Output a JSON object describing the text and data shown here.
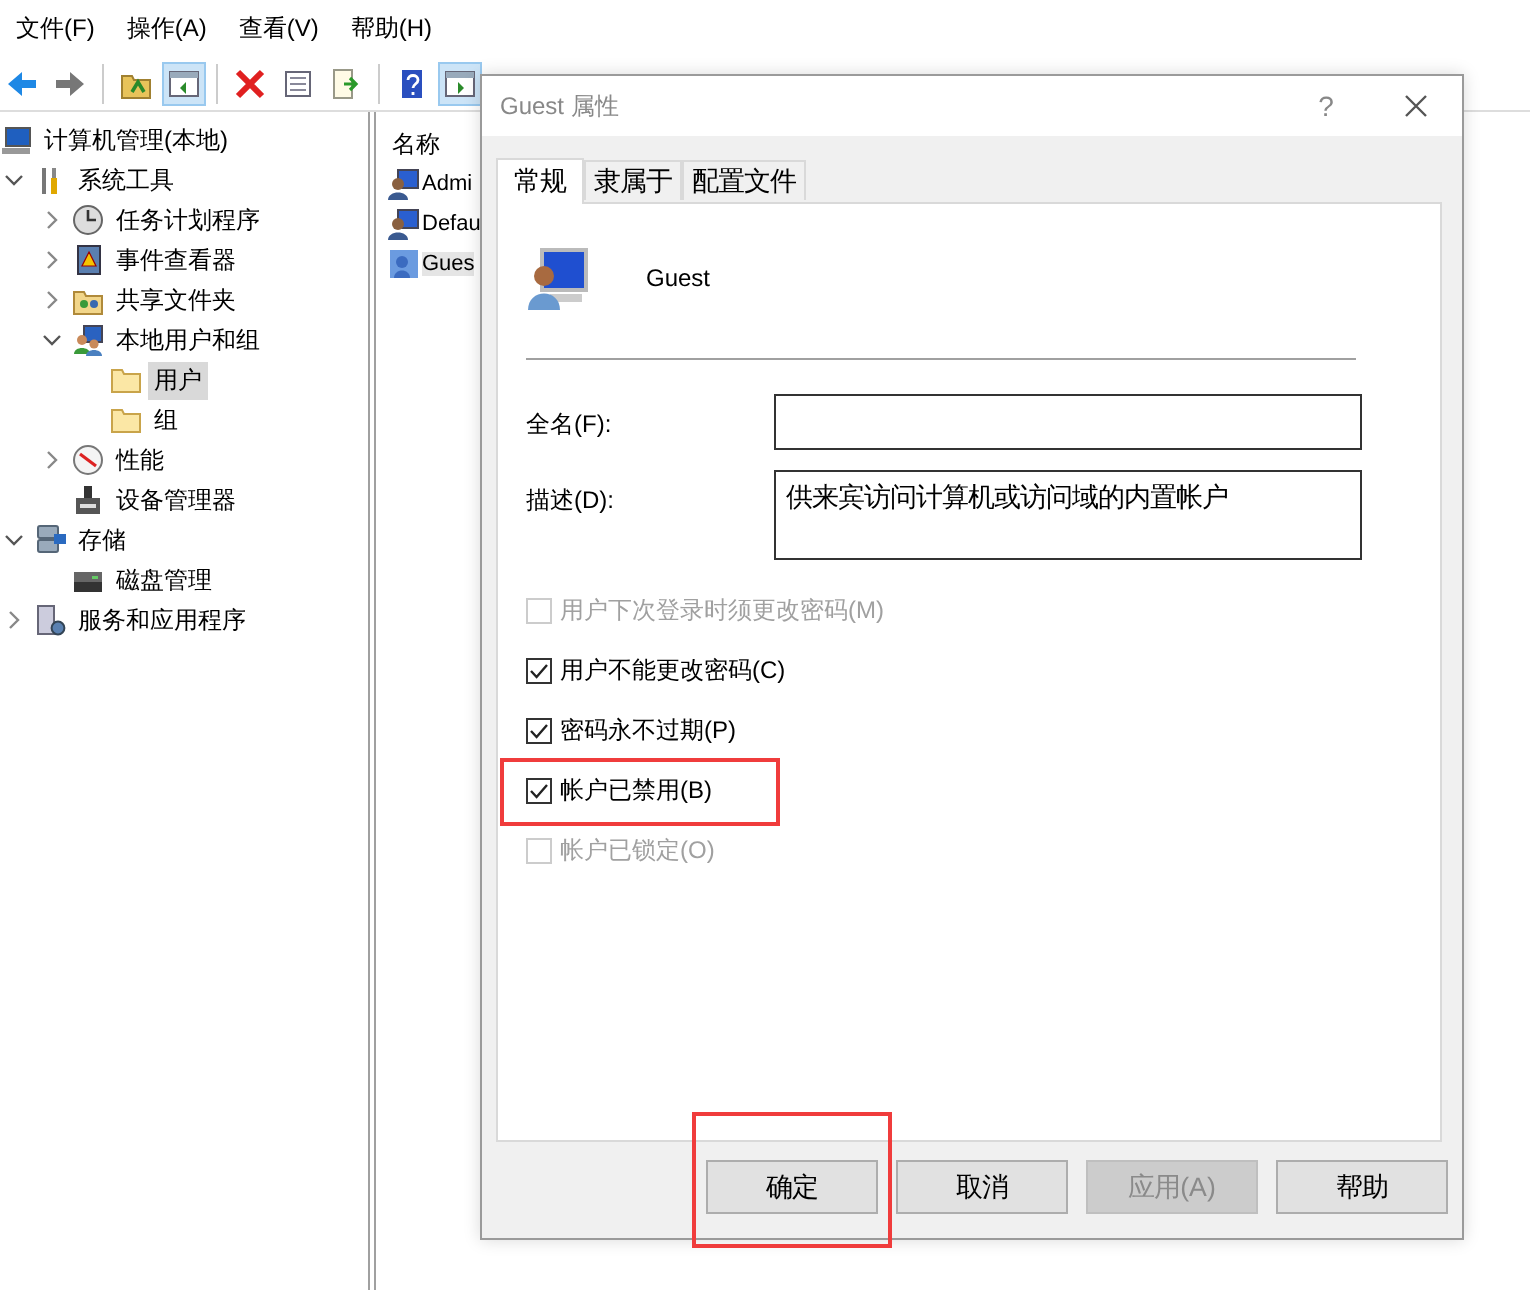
{
  "menu": [
    {
      "label": "文件(F)"
    },
    {
      "label": "操作(A)"
    },
    {
      "label": "查看(V)"
    },
    {
      "label": "帮助(H)"
    }
  ],
  "toolbar": {
    "buttons": [
      {
        "on": false
      },
      {
        "on": false
      },
      {
        "on": false
      },
      {
        "on": true
      },
      {
        "on": false
      },
      {
        "on": false
      },
      {
        "on": false
      },
      {
        "on": false
      },
      {
        "on": true
      }
    ]
  },
  "tree": {
    "items": [
      {
        "label": "计算机管理(本地)",
        "selected": false,
        "children": [
          {
            "label": "系统工具",
            "selected": false,
            "expanded": true,
            "children": [
              {
                "label": "任务计划程序",
                "selected": false,
                "expanded": false
              },
              {
                "label": "事件查看器",
                "selected": false,
                "expanded": false
              },
              {
                "label": "共享文件夹",
                "selected": false,
                "expanded": false
              },
              {
                "label": "本地用户和组",
                "selected": false,
                "expanded": true,
                "children": [
                  {
                    "label": "用户",
                    "selected": true
                  },
                  {
                    "label": "组",
                    "selected": false
                  }
                ]
              },
              {
                "label": "性能",
                "selected": false,
                "expanded": false
              },
              {
                "label": "设备管理器",
                "selected": false
              }
            ]
          },
          {
            "label": "存储",
            "selected": false,
            "expanded": true,
            "children": [
              {
                "label": "磁盘管理",
                "selected": false
              }
            ]
          },
          {
            "label": "服务和应用程序",
            "selected": false,
            "expanded": false
          }
        ]
      }
    ]
  },
  "list": {
    "columns": [
      {
        "label": "名称"
      }
    ],
    "rows": [
      {
        "name": "Admi",
        "selected": false
      },
      {
        "name": "Defau",
        "selected": false
      },
      {
        "name": "Gues",
        "selected": true
      }
    ]
  },
  "dialog": {
    "title": "Guest 属性",
    "help": "?",
    "tabs": [
      {
        "label": "常规",
        "selected": true
      },
      {
        "label": "隶属于",
        "selected": false
      },
      {
        "label": "配置文件",
        "selected": false
      }
    ],
    "user_name": "Guest",
    "fields": [
      {
        "label": "全名(F):",
        "multiline": false
      },
      {
        "label": "描述(D):",
        "value": "供来宾访问计算机或访问域的内置帐户",
        "multiline": true
      }
    ],
    "checkboxes": [
      {
        "label": "用户下次登录时须更改密码(M)",
        "checked": false,
        "disabled": true,
        "highlighted": false
      },
      {
        "label": "用户不能更改密码(C)",
        "checked": true,
        "disabled": false,
        "highlighted": false
      },
      {
        "label": "密码永不过期(P)",
        "checked": true,
        "disabled": false,
        "highlighted": false
      },
      {
        "label": "帐户已禁用(B)",
        "checked": true,
        "disabled": false,
        "highlighted": true
      },
      {
        "label": "帐户已锁定(O)",
        "checked": false,
        "disabled": true,
        "highlighted": false
      }
    ],
    "buttons": [
      {
        "label": "确定",
        "disabled": false,
        "highlighted": true
      },
      {
        "label": "取消",
        "disabled": false,
        "highlighted": false
      },
      {
        "label": "应用(A)",
        "disabled": true,
        "highlighted": false
      },
      {
        "label": "帮助",
        "disabled": false,
        "highlighted": false
      }
    ]
  }
}
